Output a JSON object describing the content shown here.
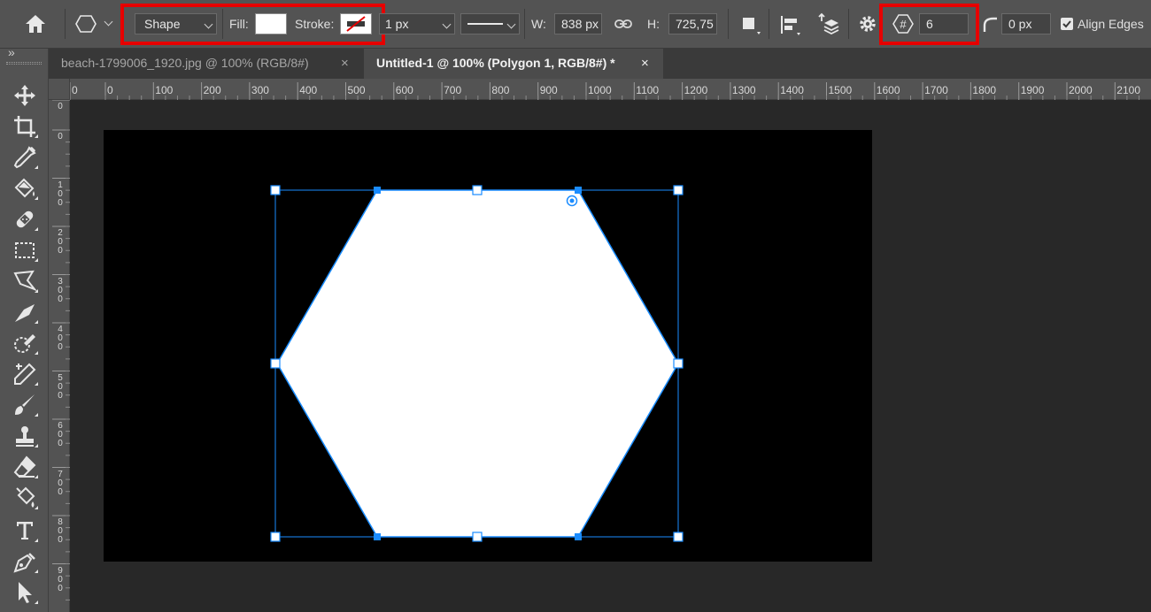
{
  "options_bar": {
    "mode_value": "Shape",
    "fill_label": "Fill:",
    "stroke_label": "Stroke:",
    "stroke_width": "1 px",
    "width_label": "W:",
    "width_value": "838 px",
    "height_label": "H:",
    "height_value": "725,75",
    "sides_value": "6",
    "corner_radius": "0 px",
    "align_edges_label": "Align Edges",
    "align_edges_checked": true,
    "fill_color": "#ffffff",
    "highlight_color": "#e60000"
  },
  "tabs": [
    {
      "label": "beach-1799006_1920.jpg @ 100% (RGB/8#)",
      "close": "×",
      "active": false
    },
    {
      "label": "Untitled-1 @ 100% (Polygon 1, RGB/8#) *",
      "close": "×",
      "active": true
    }
  ],
  "panel_toggle": "»",
  "ruler_top_labels": [
    "0",
    "0",
    "100",
    "200",
    "300",
    "400",
    "500",
    "600",
    "700",
    "800",
    "900",
    "1000",
    "1100",
    "1200",
    "1300",
    "1400",
    "1500",
    "1600",
    "1700",
    "1800",
    "1900",
    "2000",
    "2100"
  ],
  "ruler_left_labels": [
    "0",
    "0",
    "100",
    "200",
    "300",
    "400",
    "500",
    "600",
    "700",
    "800",
    "900"
  ],
  "toolbar_tools": [
    "move-tool",
    "crop-tool",
    "eyedropper-tool",
    "paint-bucket-tool",
    "healing-brush-tool",
    "marquee-tool",
    "lasso-tool",
    "pen-tool",
    "quick-selection-tool",
    "color-sampler-tool",
    "brush-tool",
    "clone-stamp-tool",
    "eraser-tool",
    "fill-tool",
    "type-tool",
    "pen-path-tool",
    "path-selection-tool"
  ],
  "canvas": {
    "background": "#000000",
    "shape": "hexagon",
    "shape_fill": "#ffffff",
    "selection_color": "#1a8cff"
  }
}
